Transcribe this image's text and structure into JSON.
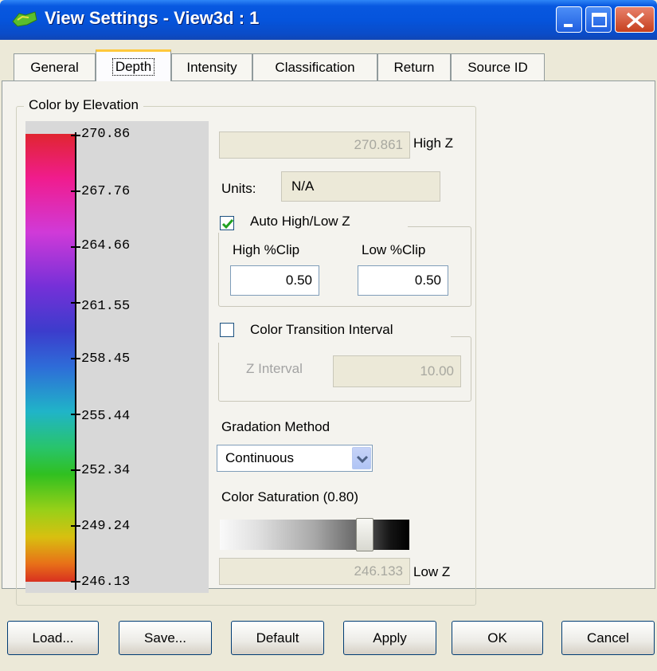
{
  "window": {
    "title": "View Settings - View3d : 1",
    "app_icon": "lidar-app-icon",
    "caption_buttons": [
      "minimize",
      "maximize",
      "close"
    ]
  },
  "tabs": [
    {
      "label": "General",
      "active": false
    },
    {
      "label": "Depth",
      "active": true
    },
    {
      "label": "Intensity",
      "active": false
    },
    {
      "label": "Classification",
      "active": false
    },
    {
      "label": "Return",
      "active": false
    },
    {
      "label": "Source ID",
      "active": false
    }
  ],
  "color_by_elevation": {
    "group_label": "Color by Elevation",
    "scale_labels": [
      "270.86",
      "267.76",
      "264.66",
      "261.55",
      "258.45",
      "255.44",
      "252.34",
      "249.24",
      "246.13"
    ],
    "high_z": {
      "value": "270.861",
      "label": "High Z"
    },
    "low_z": {
      "value": "246.133",
      "label": "Low Z"
    },
    "units": {
      "label": "Units:",
      "value": "N/A"
    },
    "auto_high_low": {
      "label": "Auto High/Low Z",
      "checked": true,
      "high_clip": {
        "label": "High %Clip",
        "value": "0.50"
      },
      "low_clip": {
        "label": "Low %Clip",
        "value": "0.50"
      }
    },
    "color_transition": {
      "label": "Color Transition Interval",
      "checked": false,
      "z_interval": {
        "label": "Z Interval",
        "value": "10.00"
      }
    },
    "gradation": {
      "label": "Gradation Method",
      "selected": "Continuous"
    },
    "saturation": {
      "label": "Color Saturation (0.80)",
      "level": 0.8
    }
  },
  "buttons": {
    "load": "Load...",
    "save": "Save...",
    "default": "Default",
    "apply": "Apply",
    "ok": "OK",
    "cancel": "Cancel"
  },
  "colors": {
    "titlebar": "#0554DC",
    "active_tab_accent": "#FFC83C",
    "close_button": "#C6401E"
  }
}
